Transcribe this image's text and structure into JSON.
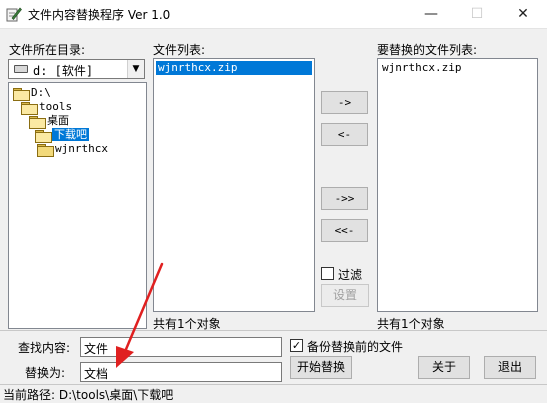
{
  "window": {
    "title": "文件内容替换程序 Ver 1.0",
    "minimize": "—",
    "maximize": "☐",
    "close": "✕"
  },
  "left": {
    "dir_label": "文件所在目录:",
    "drive": "d: [软件]",
    "tree": [
      {
        "name": "D:\\",
        "depth": 0,
        "selected": false
      },
      {
        "name": "tools",
        "depth": 1,
        "selected": false
      },
      {
        "name": "桌面",
        "depth": 2,
        "selected": false
      },
      {
        "name": "下载吧",
        "depth": 3,
        "selected": true
      },
      {
        "name": "wjnrthcx",
        "depth": 4,
        "selected": false
      }
    ]
  },
  "file_list": {
    "label": "文件列表:",
    "items": [
      "wjnrthcx.zip"
    ],
    "count": "共有1个对象"
  },
  "target_list": {
    "label": "要替换的文件列表:",
    "items": [
      "wjnrthcx.zip"
    ],
    "count": "共有1个对象"
  },
  "buttons": {
    "add_one": "->",
    "remove_one": "<-",
    "add_all": "->>",
    "remove_all": "<<-",
    "filter_label": "过滤",
    "settings": "设置",
    "start": "开始替换",
    "about": "关于",
    "exit": "退出"
  },
  "form": {
    "find_label": "查找内容:",
    "find_value": "文件",
    "replace_label": "替换为:",
    "replace_value": "文档",
    "backup_label": "备份替换前的文件",
    "backup_checked": true,
    "filter_checked": false
  },
  "status": {
    "path": "当前路径: D:\\tools\\桌面\\下载吧"
  },
  "colors": {
    "selection": "#0078d7",
    "annotation_arrow": "#e02020"
  }
}
